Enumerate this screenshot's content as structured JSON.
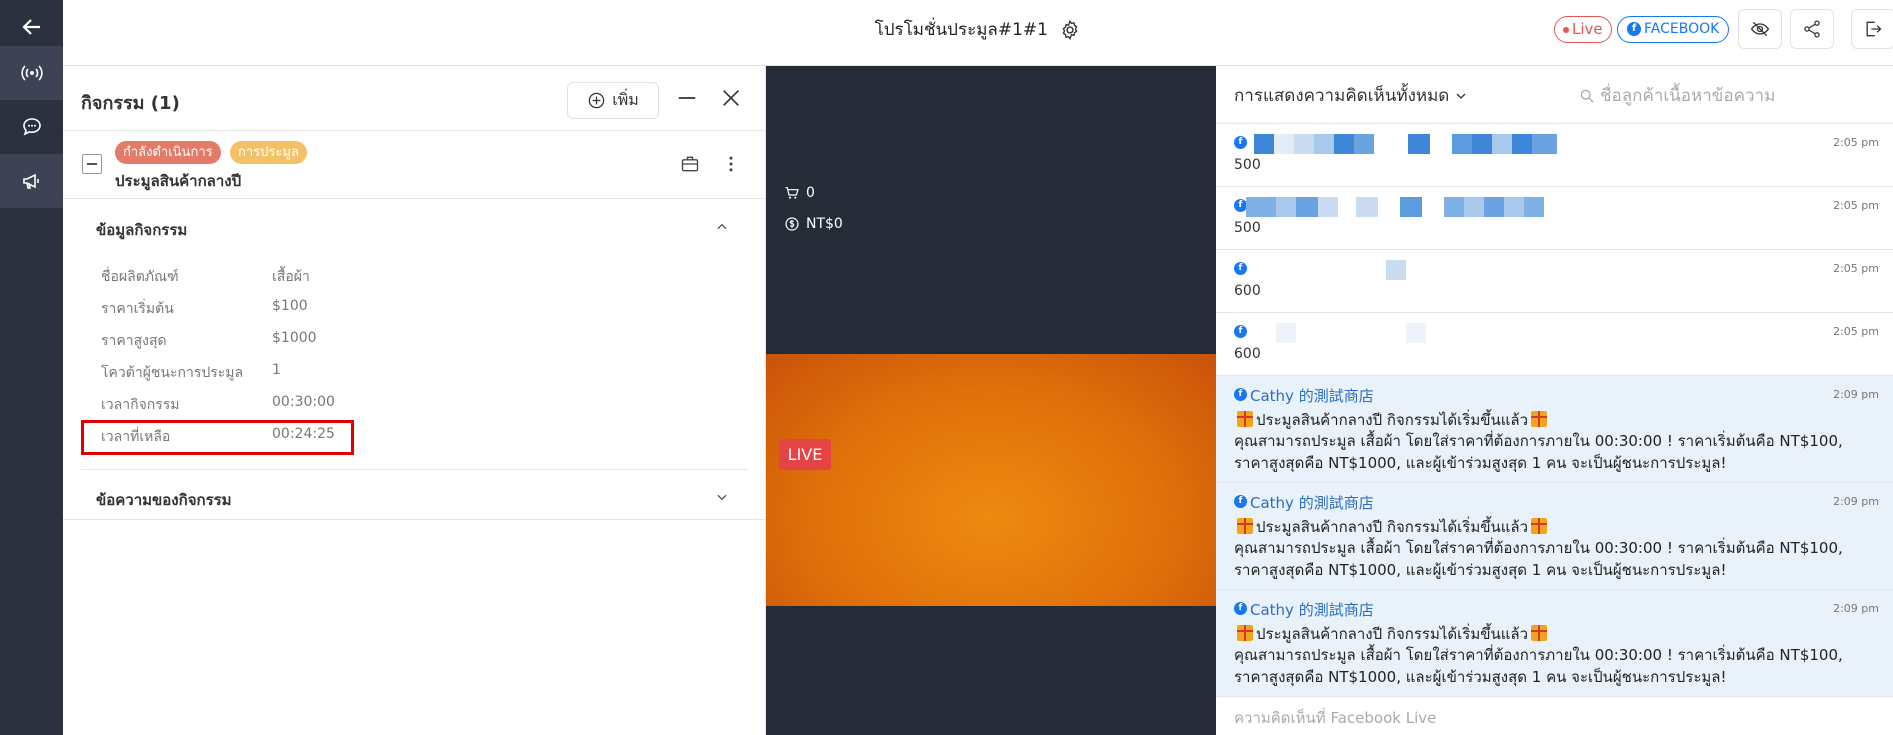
{
  "topbar": {
    "title": "โปรโมชั่นประมูล#1#1",
    "live_label": "Live",
    "facebook_label": "FACEBOOK"
  },
  "panel": {
    "title": "กิจกรรม  (1)",
    "add_label": "เพิ่ม",
    "activity": {
      "status_tag": "กำลังดำเนินการ",
      "type_tag": "การประมูล",
      "name": "ประมูลสินค้ากลางปี"
    },
    "info_section_title": "ข้อมูลกิจกรรม",
    "info": [
      {
        "label": "ชื่อผลิตภัณฑ์",
        "value": "เสื้อผ้า"
      },
      {
        "label": "ราคาเริ่มต้น",
        "value": "$100"
      },
      {
        "label": "ราคาสูงสุด",
        "value": "$1000"
      },
      {
        "label": "โควต้าผู้ชนะการประมูล",
        "value": "1"
      },
      {
        "label": "เวลากิจกรรม",
        "value": "00:30:00"
      },
      {
        "label": "เวลาที่เหลือ",
        "value": "00:24:25"
      }
    ],
    "message_section_title": "ข้อความของกิจกรรม"
  },
  "video": {
    "cart_count": "0",
    "amount": "NT$0",
    "live_badge": "LIVE"
  },
  "comments": {
    "filter_label": "การแสดงความคิดเห็นทั้งหมด",
    "search_placeholder": "ชื่อลูกค้าเนื้อหาข้อความ",
    "items": [
      {
        "time": "2:05 pm",
        "value": "500"
      },
      {
        "time": "2:05 pm",
        "value": "500"
      },
      {
        "time": "2:05 pm",
        "value": "600"
      },
      {
        "time": "2:05 pm",
        "value": "600"
      }
    ],
    "shop_items": [
      {
        "author": "Cathy 的測試商店",
        "time": "2:09 pm",
        "line1": "ประมูลสินค้ากลางปี กิจกรรมได้เริ่มขึ้นแล้ว",
        "line2": "คุณสามารถประมูล เสื้อผ้า โดยใส่ราคาที่ต้องการภายใน 00:30:00 ! ราคาเริ่มต้นคือ NT$100, ราคาสูงสุดคือ NT$1000, และผู้เข้าร่วมสูงสุด 1 คน จะเป็นผู้ชนะการประมูล!"
      },
      {
        "author": "Cathy 的測試商店",
        "time": "2:09 pm",
        "line1": "ประมูลสินค้ากลางปี กิจกรรมได้เริ่มขึ้นแล้ว",
        "line2": "คุณสามารถประมูล เสื้อผ้า โดยใส่ราคาที่ต้องการภายใน 00:30:00 ! ราคาเริ่มต้นคือ NT$100, ราคาสูงสุดคือ NT$1000, และผู้เข้าร่วมสูงสุด 1 คน จะเป็นผู้ชนะการประมูล!"
      },
      {
        "author": "Cathy 的測試商店",
        "time": "2:09 pm",
        "line1": "ประมูลสินค้ากลางปี กิจกรรมได้เริ่มขึ้นแล้ว",
        "line2": "คุณสามารถประมูล เสื้อผ้า โดยใส่ราคาที่ต้องการภายใน 00:30:00 ! ราคาเริ่มต้นคือ NT$100, ราคาสูงสุดคือ NT$1000, และผู้เข้าร่วมสูงสุด 1 คน จะเป็นผู้ชนะการประมูล!"
      }
    ],
    "footer": "ความคิดเห็นที่ Facebook Live"
  },
  "colors": {
    "nav_bg": "#2c3140",
    "video_bg": "#262b38",
    "accent_blue": "#1877f2",
    "live_red": "#e35656",
    "highlight_red": "#e00000"
  }
}
